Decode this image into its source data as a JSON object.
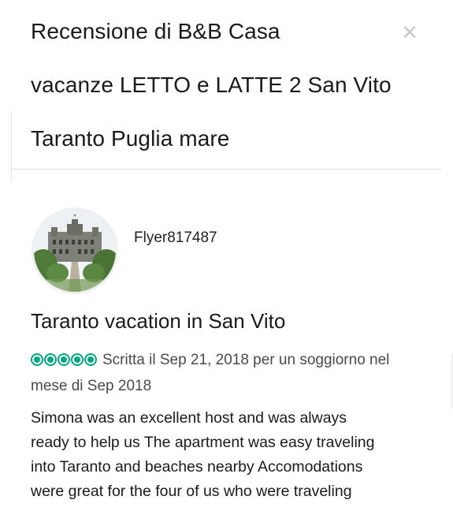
{
  "header": {
    "title_lines": [
      "Recensione di B&B Casa",
      "vacanze LETTO e LATTE 2 San Vito",
      "Taranto Puglia mare"
    ],
    "close_icon": "close-icon"
  },
  "review": {
    "avatar_icon": "castle-photo-avatar",
    "username": "Flyer817487",
    "title": "Taranto vacation in San Vito",
    "rating": {
      "value": 5,
      "max": 5,
      "color": "#00a680"
    },
    "meta_text": "Scritta il Sep 21, 2018 per un soggiorno nel mese di Sep 2018",
    "body_lines": [
      "Simona was an excellent host and was always",
      "ready to help us The apartment was easy traveling",
      "into Taranto and beaches nearby Accomodations",
      "were great for the four of us who were traveling"
    ]
  }
}
